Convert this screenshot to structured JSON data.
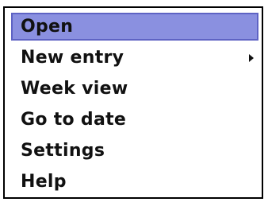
{
  "menu": {
    "items": [
      {
        "label": "Open",
        "selected": true,
        "has_submenu": false
      },
      {
        "label": "New entry",
        "selected": false,
        "has_submenu": true
      },
      {
        "label": "Week view",
        "selected": false,
        "has_submenu": false
      },
      {
        "label": "Go to date",
        "selected": false,
        "has_submenu": false
      },
      {
        "label": "Settings",
        "selected": false,
        "has_submenu": false
      },
      {
        "label": "Help",
        "selected": false,
        "has_submenu": false
      }
    ],
    "submenu_icon": "chevron-right-icon",
    "highlight_color": "#8a90e0"
  }
}
